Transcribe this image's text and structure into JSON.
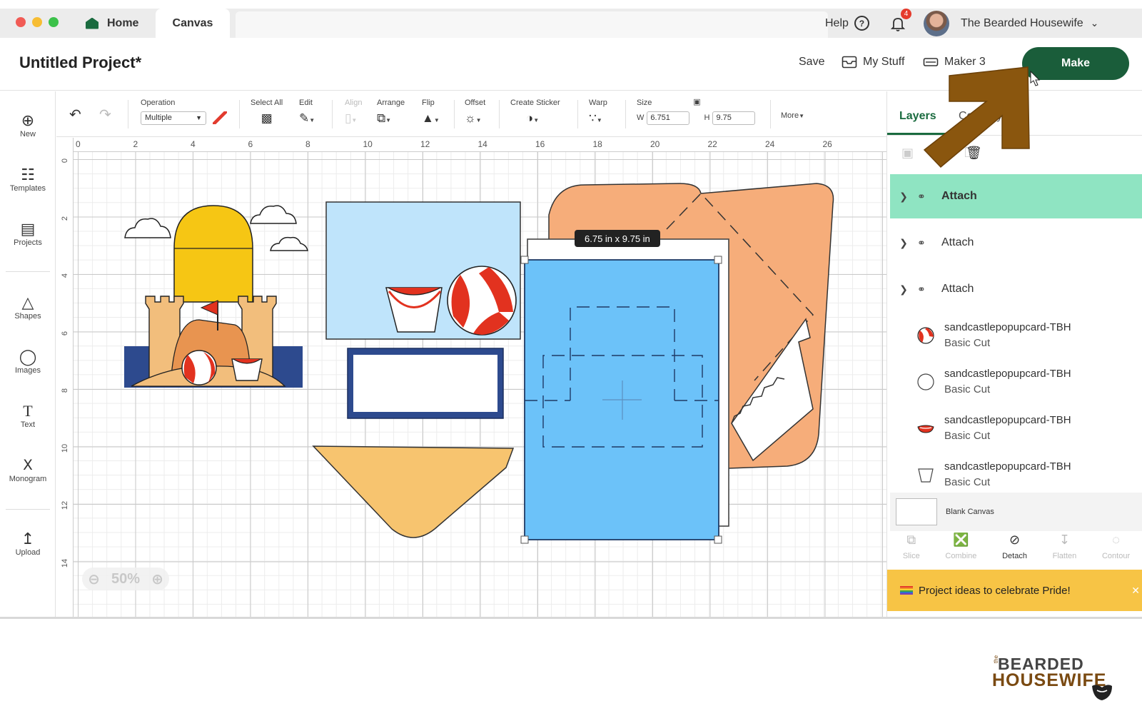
{
  "tabs": {
    "home": "Home",
    "canvas": "Canvas"
  },
  "topbar": {
    "help": "Help",
    "notification_count": "4",
    "user_name": "The Bearded Housewife"
  },
  "header": {
    "project_title": "Untitled Project*",
    "save": "Save",
    "my_stuff": "My Stuff",
    "maker": "Maker 3",
    "make": "Make"
  },
  "rail": {
    "new": "New",
    "templates": "Templates",
    "projects": "Projects",
    "shapes": "Shapes",
    "images": "Images",
    "text": "Text",
    "monogram": "Monogram",
    "upload": "Upload"
  },
  "toolbar": {
    "operation_label": "Operation",
    "operation_value": "Multiple",
    "select_all": "Select All",
    "edit": "Edit",
    "align": "Align",
    "arrange": "Arrange",
    "flip": "Flip",
    "offset": "Offset",
    "create_sticker": "Create Sticker",
    "warp": "Warp",
    "size_label": "Size",
    "w_label": "W",
    "w_value": "6.751",
    "h_label": "H",
    "h_value": "9.75",
    "more": "More"
  },
  "ruler": {
    "top": [
      "0",
      "2",
      "4",
      "6",
      "8",
      "10",
      "12",
      "14",
      "16",
      "18",
      "20",
      "22",
      "24",
      "26"
    ],
    "left": [
      "0",
      "2",
      "4",
      "6",
      "8",
      "10",
      "12",
      "14"
    ]
  },
  "canvas": {
    "size_tooltip": "6.75  in x 9.75  in",
    "zoom": "50%"
  },
  "panel": {
    "tab_layers": "Layers",
    "tab_color": "Color Sync",
    "layers": [
      {
        "name": "Attach",
        "type": "group",
        "selected": true
      },
      {
        "name": "Attach",
        "type": "group",
        "selected": false
      },
      {
        "name": "Attach",
        "type": "group",
        "selected": false
      },
      {
        "name": "sandcastlepopupcard-TBH",
        "sub": "Basic Cut",
        "thumb": "beach-ball-icon"
      },
      {
        "name": "sandcastlepopupcard-TBH",
        "sub": "Basic Cut",
        "thumb": "circle-icon"
      },
      {
        "name": "sandcastlepopupcard-TBH",
        "sub": "Basic Cut",
        "thumb": "lips-icon"
      },
      {
        "name": "sandcastlepopupcard-TBH",
        "sub": "Basic Cut",
        "thumb": "bucket-icon"
      }
    ],
    "blank_canvas": "Blank Canvas",
    "tools": {
      "slice": "Slice",
      "combine": "Combine",
      "detach": "Detach",
      "flatten": "Flatten",
      "contour": "Contour"
    },
    "promo": "Project ideas to celebrate Pride!"
  },
  "brand": {
    "the": "the",
    "line1": "BEARDED",
    "line2": "HOUSEWIFE"
  },
  "colors": {
    "make_button": "#1a5d3a",
    "selected_layer": "#8fe4c2",
    "promo": "#f7c445",
    "arrow": "#8a560e"
  }
}
